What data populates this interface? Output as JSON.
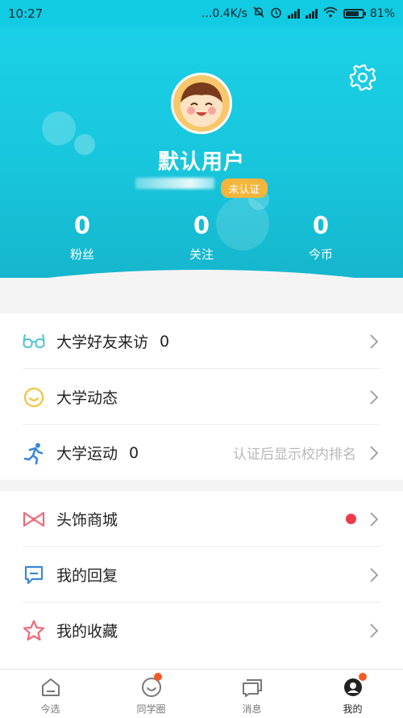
{
  "status_bar": {
    "time": "10:27",
    "network_speed": "...0.4K/s",
    "battery_percent": "81%",
    "battery_level": 0.81
  },
  "profile": {
    "username": "默认用户",
    "cert_badge": "未认证",
    "stats": [
      {
        "value": "0",
        "label": "粉丝"
      },
      {
        "value": "0",
        "label": "关注"
      },
      {
        "value": "0",
        "label": "今币"
      }
    ]
  },
  "menu_group_1": [
    {
      "icon": "glasses-icon",
      "title": "大学好友来访",
      "count": "0",
      "hint": "",
      "color": "#5cc7d6"
    },
    {
      "icon": "smile-icon",
      "title": "大学动态",
      "count": "",
      "hint": "",
      "color": "#f3c23c"
    },
    {
      "icon": "running-icon",
      "title": "大学运动",
      "count": "0",
      "hint": "认证后显示校内排名",
      "color": "#3a88d6"
    }
  ],
  "menu_group_2": [
    {
      "icon": "bow-icon",
      "title": "头饰商城",
      "count": "",
      "hint": "",
      "color": "#ef6a7a",
      "badge_dot": true
    },
    {
      "icon": "reply-icon",
      "title": "我的回复",
      "count": "",
      "hint": "",
      "color": "#3a88d6"
    },
    {
      "icon": "star-icon",
      "title": "我的收藏",
      "count": "",
      "hint": "",
      "color": "#ef6a7a"
    }
  ],
  "bottom_nav": [
    {
      "icon": "home-icon",
      "label": "今选",
      "dot": false,
      "active": false
    },
    {
      "icon": "smile-icon",
      "label": "同学圈",
      "dot": true,
      "active": false
    },
    {
      "icon": "message-icon",
      "label": "消息",
      "dot": false,
      "active": false
    },
    {
      "icon": "profile-icon",
      "label": "我的",
      "dot": true,
      "active": true
    }
  ],
  "colors": {
    "header": "#18c6dc",
    "badge": "#f4b53c",
    "dot": "#ee3b4a"
  }
}
